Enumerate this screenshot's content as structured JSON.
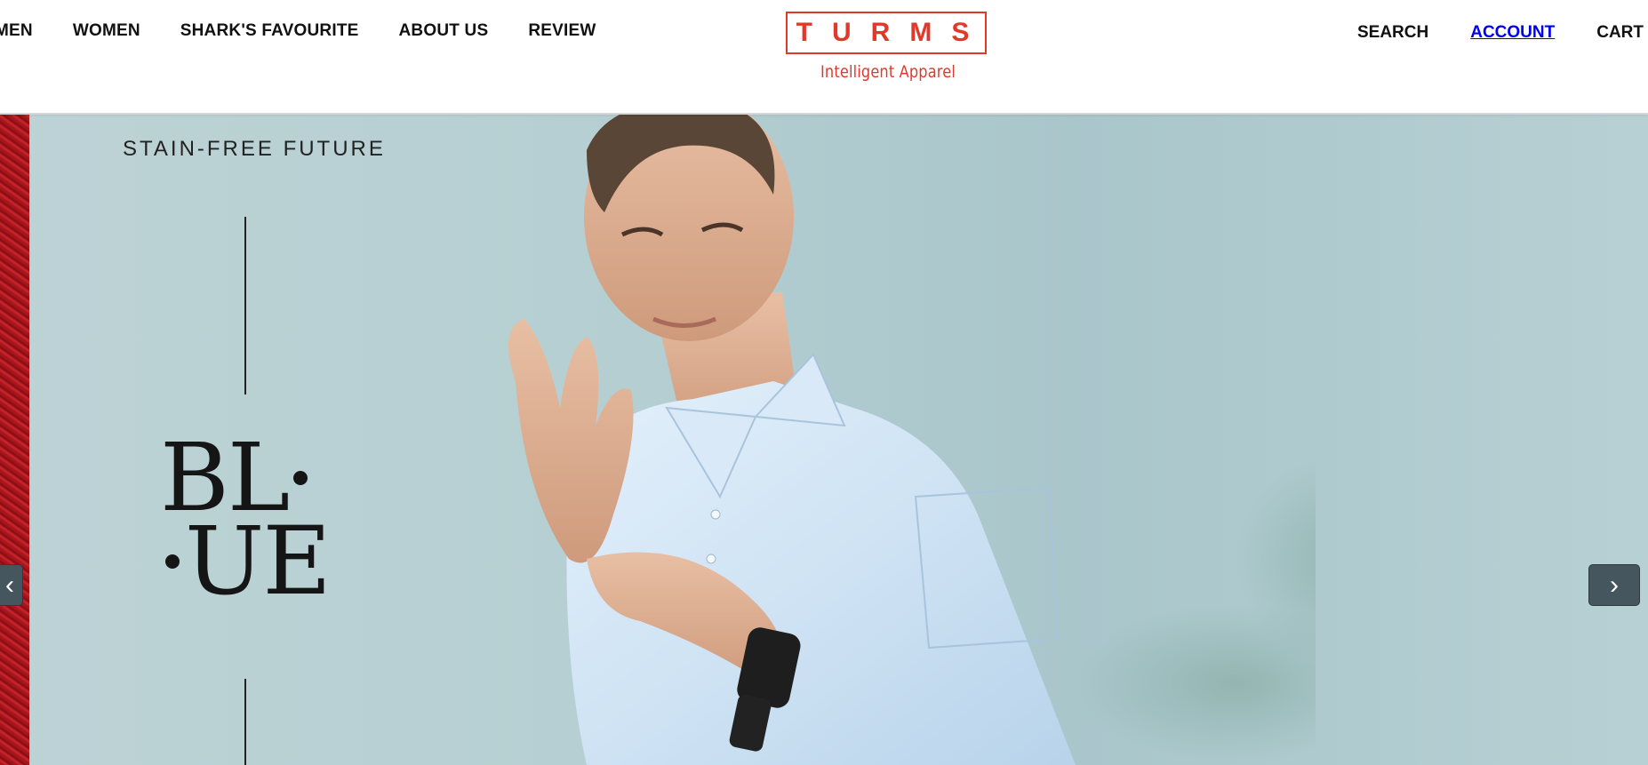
{
  "nav": {
    "left": [
      "MEN",
      "WOMEN",
      "SHARK'S FAVOURITE",
      "ABOUT US",
      "REVIEW"
    ],
    "right": {
      "search": "SEARCH",
      "account": "ACCOUNT",
      "cart": "CART"
    }
  },
  "logo": {
    "brand": "TURMS",
    "tagline": "Intelligent Apparel"
  },
  "hero": {
    "kicker": "STAIN-FREE FUTURE",
    "title_line1": "BL",
    "title_line2": "UE",
    "next_arrow": "›",
    "prev_arrow": "‹"
  },
  "colors": {
    "brand_red": "#e0392b",
    "link_blue": "#0000ee",
    "arrow_bg": "#46565e"
  },
  "icons": {
    "next": "chevron-right-icon",
    "prev": "chevron-left-icon"
  }
}
